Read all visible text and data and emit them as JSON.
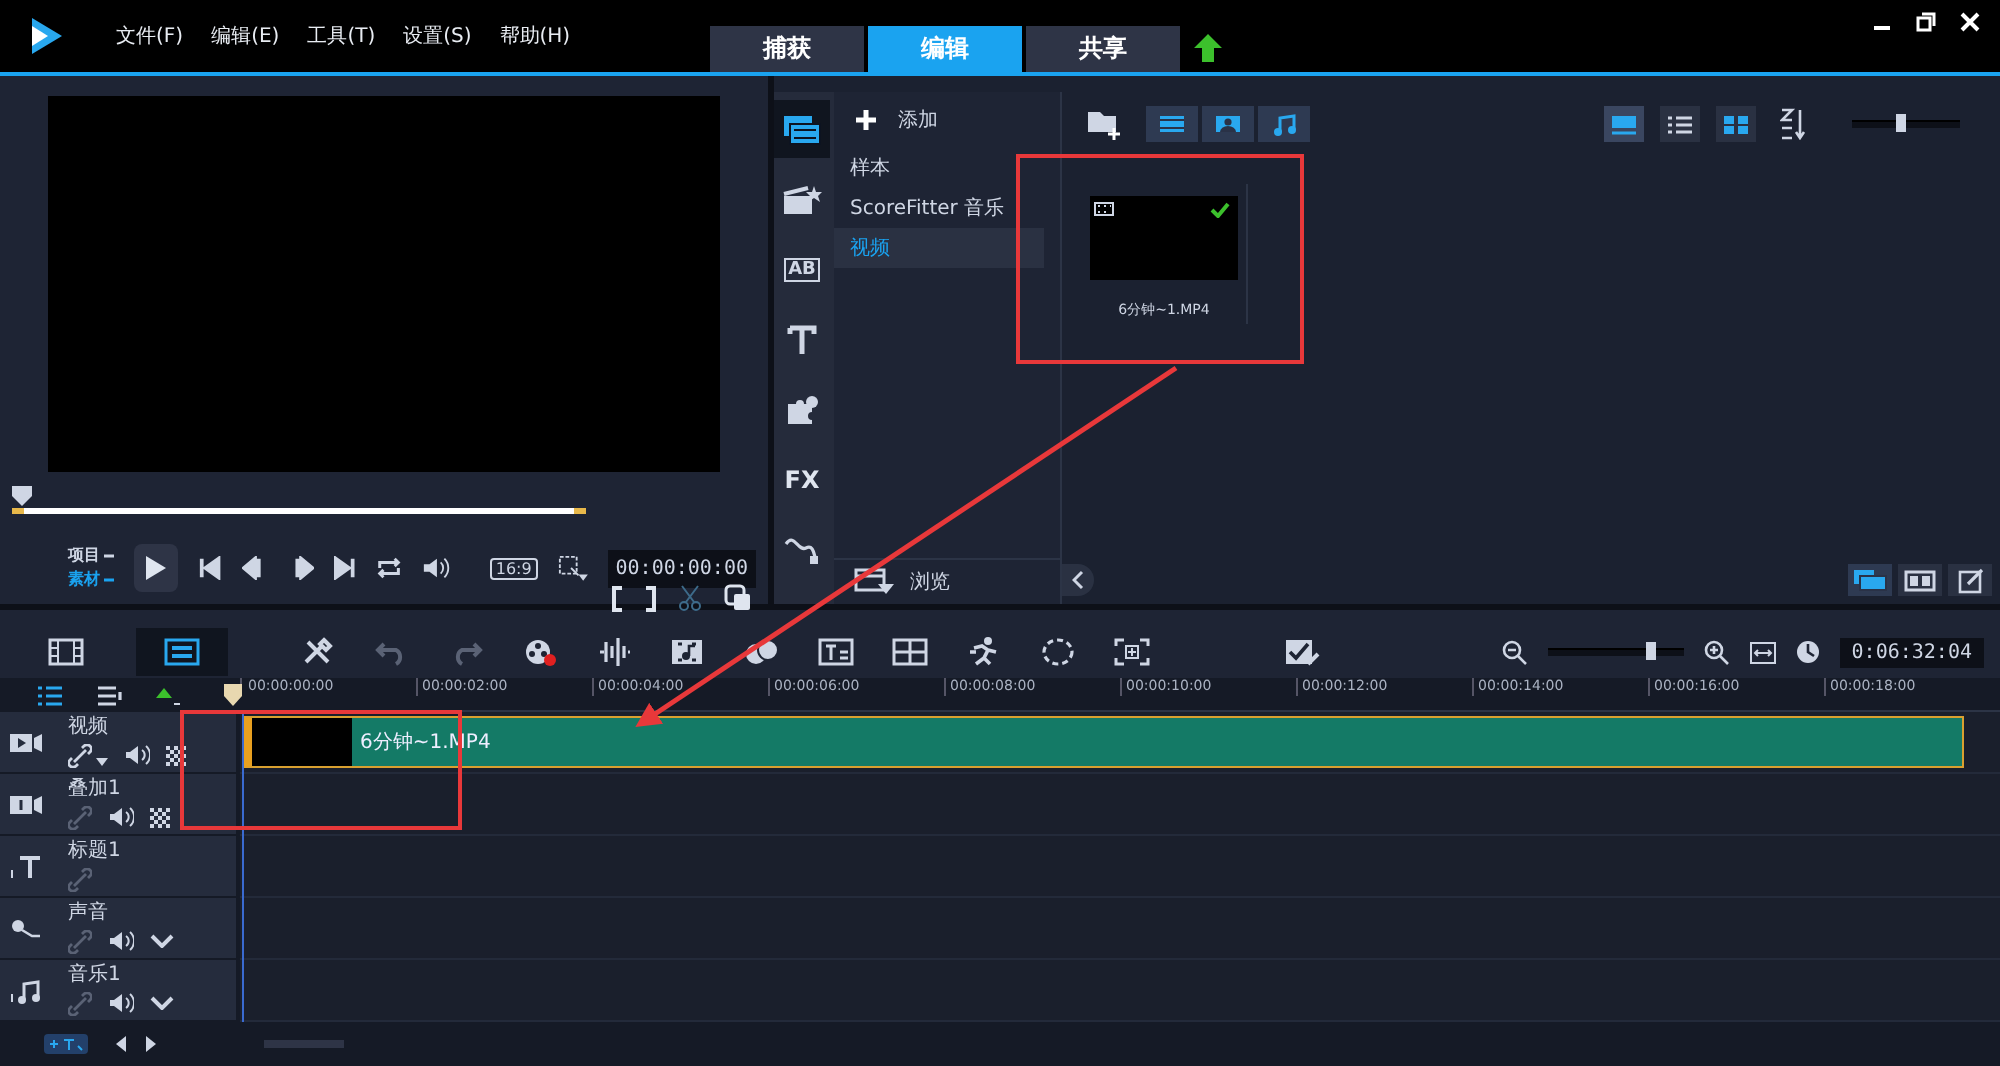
{
  "menu": [
    "文件(F)",
    "编辑(E)",
    "工具(T)",
    "设置(S)",
    "帮助(H)"
  ],
  "tabs": [
    {
      "label": "捕获",
      "selected": false
    },
    {
      "label": "编辑",
      "selected": true
    },
    {
      "label": "共享",
      "selected": false
    }
  ],
  "preview": {
    "modes": [
      {
        "label": "项目",
        "selected": false
      },
      {
        "label": "素材",
        "selected": true
      }
    ],
    "aspect": "16:9",
    "timecode": "00:00:00:00"
  },
  "library": {
    "tools": [
      {
        "kind": "media",
        "selected": true
      },
      {
        "kind": "instant",
        "selected": false
      },
      {
        "kind": "transition",
        "label": "AB",
        "selected": false
      },
      {
        "kind": "title",
        "selected": false
      },
      {
        "kind": "graphics",
        "selected": false
      },
      {
        "kind": "filter",
        "label": "FX",
        "selected": false
      },
      {
        "kind": "path",
        "selected": false
      }
    ],
    "add_label": "添加",
    "categories": [
      {
        "label": "样本",
        "selected": false
      },
      {
        "label": "ScoreFitter 音乐",
        "selected": false
      },
      {
        "label": "视频",
        "selected": true
      }
    ],
    "browse_label": "浏览",
    "views": [
      {
        "kind": "thumbnail",
        "selected": true
      },
      {
        "kind": "list",
        "selected": false
      },
      {
        "kind": "grid",
        "selected": false
      }
    ],
    "zoom": {
      "level": 0.45
    },
    "clips": [
      {
        "name": "6分钟~1.MP4",
        "checked": true
      }
    ]
  },
  "timeline": {
    "views": [
      {
        "kind": "storyboard",
        "selected": false
      },
      {
        "kind": "timeline",
        "selected": true
      }
    ],
    "zoom": {
      "level": 0.75
    },
    "timecode": "0:06:32:04",
    "ruler": [
      "00:00:00:00",
      "00:00:02:00",
      "00:00:04:00",
      "00:00:06:00",
      "00:00:08:00",
      "00:00:10:00",
      "00:00:12:00",
      "00:00:14:00",
      "00:00:16:00",
      "00:00:18:00"
    ],
    "tracks": [
      {
        "kind": "video",
        "name": "视频",
        "clips": [
          {
            "name": "6分钟~1.MP4"
          }
        ]
      },
      {
        "kind": "overlay",
        "name": "叠加1"
      },
      {
        "kind": "title",
        "name": "标题1"
      },
      {
        "kind": "voice",
        "name": "声音"
      },
      {
        "kind": "music",
        "name": "音乐1"
      }
    ]
  }
}
